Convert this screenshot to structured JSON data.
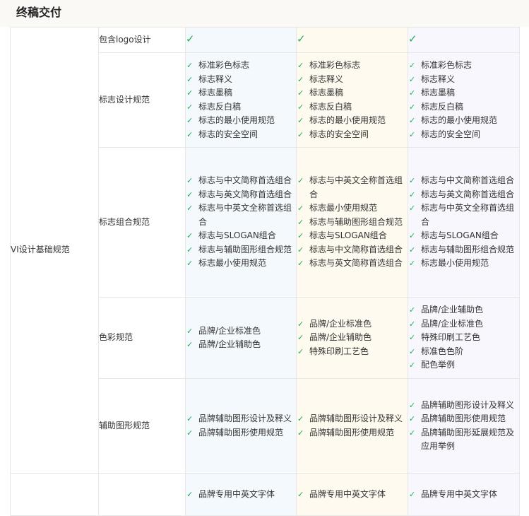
{
  "section": {
    "title": "终稿交付"
  },
  "icons": {
    "check": "✓",
    "check_color": "#1fae5a"
  },
  "category": {
    "label": "VI设计基础规范"
  },
  "rows": [
    {
      "label": "包含logo设计",
      "tick": "✓"
    },
    {
      "label": "标志设计规范",
      "col1": [
        "标准彩色标志",
        "标志释义",
        "标志墨稿",
        "标志反白稿",
        "标志的最小使用规范",
        "标志的安全空间"
      ],
      "col2": [
        "标准彩色标志",
        "标志释义",
        "标志墨稿",
        "标志反白稿",
        "标志的最小使用规范",
        "标志的安全空间"
      ],
      "col3": [
        "标准彩色标志",
        "标志释义",
        "标志墨稿",
        "标志反白稿",
        "标志的最小使用规范",
        "标志的安全空间"
      ]
    },
    {
      "label": "标志组合规范",
      "col1": [
        "标志与中文简称首选组合",
        "标志与英文简称首选组合",
        "标志与中英文全称首选组合",
        "标志与SLOGAN组合",
        "标志与辅助图形组合规范",
        "标志最小使用规范"
      ],
      "col2": [
        "标志与中英文全称首选组合",
        "标志最小使用规范",
        "标志与辅助图形组合规范",
        "标志与SLOGAN组合",
        "标志与中文简称首选组合",
        "标志与英文简称首选组合"
      ],
      "col3": [
        "标志与中文简称首选组合",
        "标志与英文简称首选组合",
        "标志与中英文全称首选组合",
        "标志与SLOGAN组合",
        "标志与辅助图形组合规范",
        "标志最小使用规范"
      ]
    },
    {
      "label": "色彩规范",
      "col1": [
        "品牌/企业标准色",
        "品牌/企业辅助色"
      ],
      "col2": [
        "品牌/企业标准色",
        "品牌/企业辅助色",
        "特殊印刷工艺色"
      ],
      "col3": [
        "品牌/企业辅助色",
        "品牌/企业标准色",
        "特殊印刷工艺色",
        "标准色色阶",
        "配色举例"
      ]
    },
    {
      "label": "辅助图形规范",
      "col1": [
        "品牌辅助图形设计及释义",
        "品牌辅助图形使用规范"
      ],
      "col2": [
        "品牌辅助图形设计及释义",
        "品牌辅助图形使用规范"
      ],
      "col3": [
        "品牌辅助图形设计及释义",
        "品牌辅助图形使用规范",
        "品牌辅助图形延展规范及应用举例"
      ]
    },
    {
      "label": "",
      "col1": [
        "品牌专用中英文字体"
      ],
      "col2": [
        "品牌专用中英文字体"
      ],
      "col3": [
        "品牌专用中英文字体"
      ]
    }
  ]
}
